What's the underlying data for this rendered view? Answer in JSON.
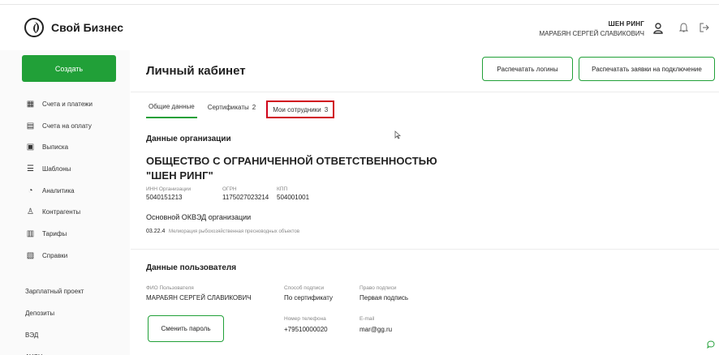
{
  "header": {
    "logo_text": "Свой Бизнес",
    "user_company": "ШЕН РИНГ",
    "user_name": "МАРАБЯН СЕРГЕЙ СЛАВИКОВИЧ",
    "avatar_glyph": "ᴼ",
    "bell_glyph": "🔔︎",
    "exit_glyph": "⇥"
  },
  "sidebar": {
    "create_label": "Создать",
    "items": [
      {
        "label": "Счета и платежи",
        "icon": "grid-icon",
        "glyph": "▦"
      },
      {
        "label": "Счета на оплату",
        "icon": "invoice-icon",
        "glyph": "▤"
      },
      {
        "label": "Выписка",
        "icon": "document-icon",
        "glyph": "▣"
      },
      {
        "label": "Шаблоны",
        "icon": "list-icon",
        "glyph": "☰"
      },
      {
        "label": "Аналитика",
        "icon": "chart-icon",
        "glyph": "◔"
      },
      {
        "label": "Контрагенты",
        "icon": "person-icon",
        "glyph": "♙"
      },
      {
        "label": "Тарифы",
        "icon": "tariff-icon",
        "glyph": "▥"
      },
      {
        "label": "Справки",
        "icon": "certificate-icon",
        "glyph": "▧"
      }
    ],
    "bottom_items": [
      {
        "label": "Зарплатный проект"
      },
      {
        "label": "Депозиты"
      },
      {
        "label": "ВЭД"
      },
      {
        "label": "АУСН"
      }
    ]
  },
  "main": {
    "title": "Личный кабинет",
    "print_logins_label": "Распечатать логины",
    "print_requests_label": "Распечатать заявки на подключение",
    "tabs": [
      {
        "label": "Общие данные",
        "badge": ""
      },
      {
        "label": "Сертификаты",
        "badge": "2"
      },
      {
        "label": "Мои сотрудники",
        "badge": "3"
      }
    ],
    "org_section_title": "Данные организации",
    "org_name": "ОБЩЕСТВО С ОГРАНИЧЕННОЙ ОТВЕТСТВЕННОСТЬЮ \"ШЕН РИНГ\"",
    "inn_label": "ИНН Организации",
    "inn_value": "5040151213",
    "ogrn_label": "ОГРН",
    "ogrn_value": "1175027023214",
    "kpp_label": "КПП",
    "kpp_value": "504001001",
    "okved_title": "Основной ОКВЭД организации",
    "okved_code": "03.22.4",
    "okved_desc": "Мелиорация рыбохозяйственная пресноводных объектов",
    "user_section_title": "Данные пользователя",
    "fio_label": "ФИО Пользователя",
    "fio_value": "МАРАБЯН СЕРГЕЙ СЛАВИКОВИЧ",
    "sign_method_label": "Способ подписи",
    "sign_method_value": "По сертификату",
    "sign_right_label": "Право подписи",
    "sign_right_value": "Первая подпись",
    "phone_label": "Номер телефона",
    "phone_value": "+79510000020",
    "email_label": "E-mail",
    "email_value": "mar@gg.ru",
    "change_password_label": "Сменить пароль"
  },
  "colors": {
    "accent": "#21a038",
    "highlight": "#d0021b"
  }
}
